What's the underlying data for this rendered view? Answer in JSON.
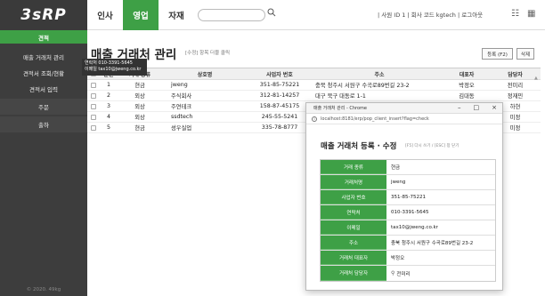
{
  "app": {
    "logo": "3sRP"
  },
  "topnav": [
    {
      "label": "인사",
      "active": false
    },
    {
      "label": "영업",
      "active": true
    },
    {
      "label": "자재",
      "active": false
    }
  ],
  "search": {
    "placeholder": ""
  },
  "user": {
    "info": "| 사원 ID 1 | 회사 코드 kgtech |  로그아웃"
  },
  "sidebar": {
    "items": [
      {
        "label": "견적"
      },
      {
        "label": "매출 거래처 관리"
      },
      {
        "label": "견적서 조회/현황"
      },
      {
        "label": "견적서 입력"
      },
      {
        "label": "주문"
      },
      {
        "label": "출하"
      }
    ],
    "footer": "© 2020. 49kg"
  },
  "page": {
    "title": "매출 거래처 관리",
    "hint": "[수정] 항목 더블 클릭",
    "register_btn": "등록 (F2)",
    "delete_btn": "삭제"
  },
  "table": {
    "headers": [
      "순번",
      "거래 종류",
      "상호명",
      "사업자 번호",
      "주소",
      "대표자",
      "담당자"
    ],
    "rows": [
      [
        "1",
        "현금",
        "jweng",
        "351-85-75221",
        "충북 청주시 서원구 수곡로89번길 23-2",
        "박정오",
        "전미리"
      ],
      [
        "2",
        "외상",
        "주식회사",
        "312-81-14257",
        "대구 북구 대동로 1-1",
        "김대동",
        "정재민"
      ],
      [
        "3",
        "외상",
        "주연테크",
        "158-87-45175",
        "",
        "",
        "하현"
      ],
      [
        "4",
        "외상",
        "ssdtech",
        "245-55-5241",
        "",
        "",
        "미정"
      ],
      [
        "5",
        "현금",
        "성우실업",
        "335-78-8777",
        "",
        "",
        "미정"
      ]
    ]
  },
  "tooltip": {
    "line1": "연락처  010-3391-5645",
    "line2": "이메일  tax10@jweng.co.kr"
  },
  "popup": {
    "window_title": "매출 거래처 관리 - Chrome",
    "url": "localhost:8181/erp/pop_client_insert?flag=check",
    "heading": "매출 거래처 등록 · 수정",
    "hint": "[F5] 다시 쓰기 / [ESC] 창 닫기",
    "fields": [
      {
        "label": "거래 종류",
        "value": "현금"
      },
      {
        "label": "거래처명",
        "value": "jweng"
      },
      {
        "label": "사업자 번호",
        "value": "351-85-75221"
      },
      {
        "label": "연락처",
        "value": "010-3391-5645"
      },
      {
        "label": "이메일",
        "value": "tax10@jweng.co.kr"
      },
      {
        "label": "주소",
        "value": "충북 청주시 서원구 수곡로89번길 23-2"
      },
      {
        "label": "거래처 대표자",
        "value": "박정오"
      },
      {
        "label": "거래처 담당자",
        "value": "전미리"
      }
    ]
  }
}
